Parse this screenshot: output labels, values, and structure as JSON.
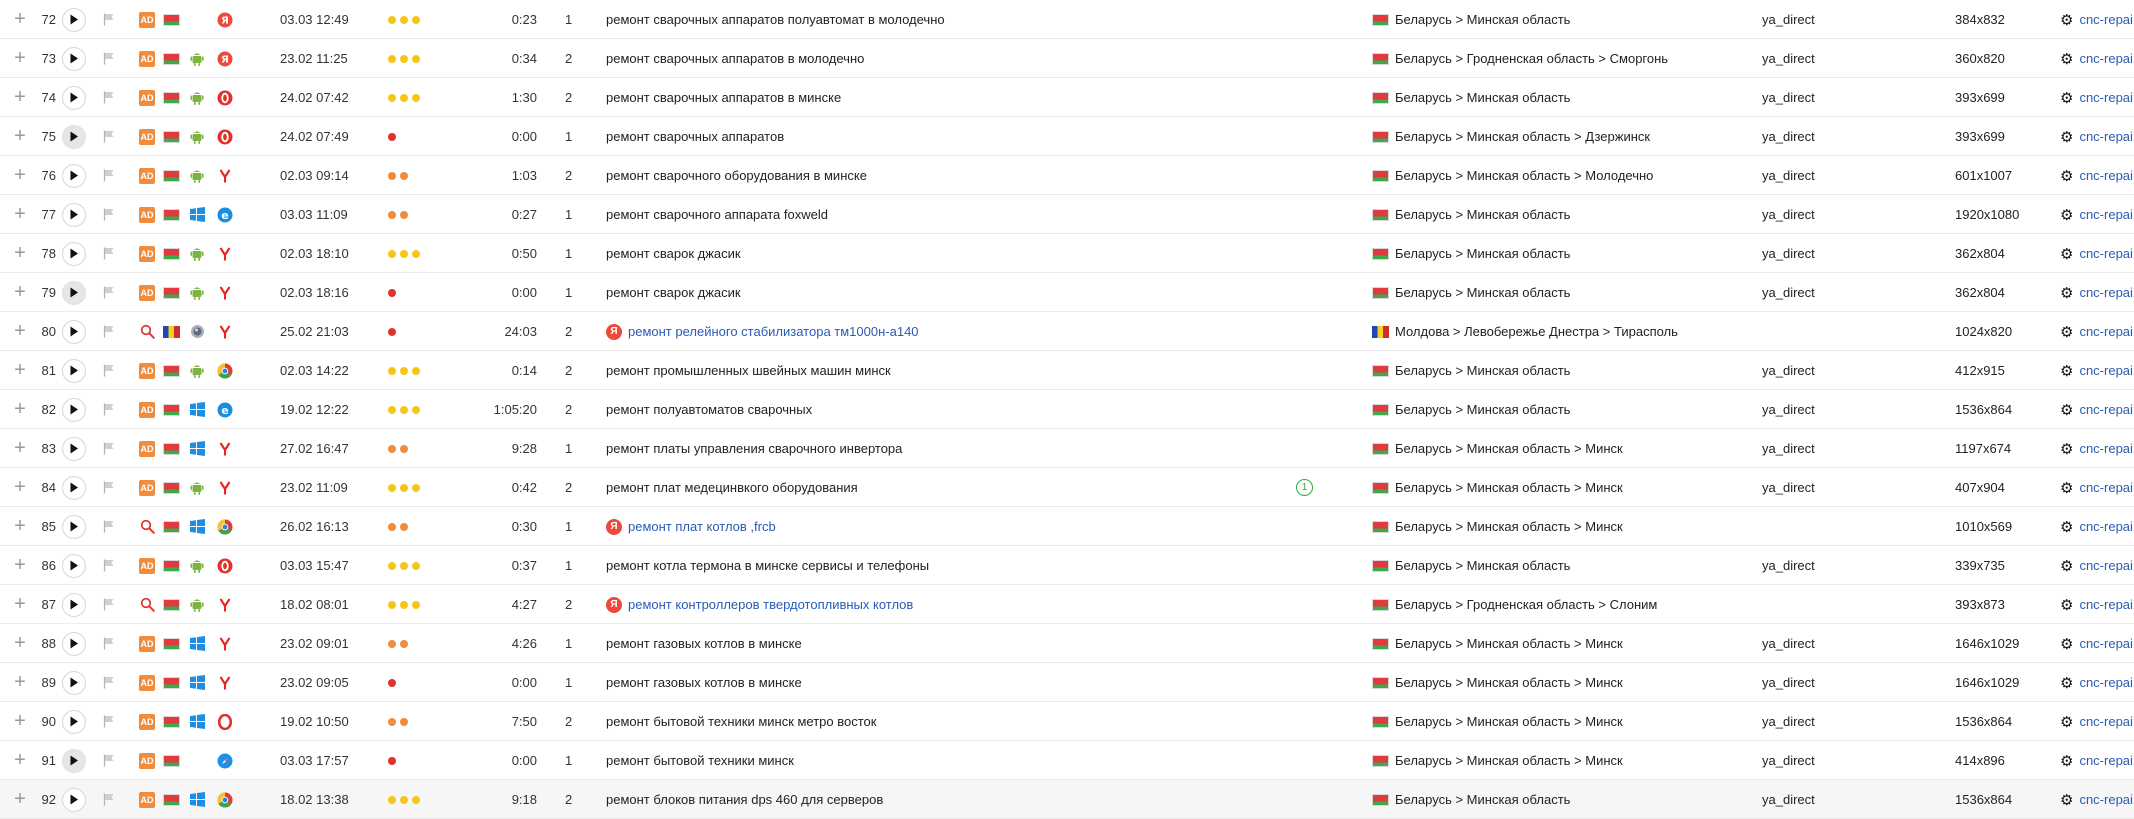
{
  "colors": {
    "dot_orange": "#f08c3c",
    "dot_yellow": "#f5c518",
    "dot_red": "#e0322d",
    "link": "#2a5bb6",
    "ad_badge": "#f08c3c"
  },
  "labels": {
    "ad_badge": "AD",
    "expand_glyph": "+",
    "gear_glyph": "⚙",
    "yandex_glyph": "Я"
  },
  "rows": [
    {
      "num": "72",
      "play_enabled": true,
      "source": "ad",
      "country": "by",
      "os": "none",
      "browser": "yandex-red",
      "date": "03.03 12:49",
      "dots": [
        "y",
        "y",
        "y"
      ],
      "duration": "0:23",
      "depth": "1",
      "phrase": "ремонт сварочных аппаратов полуавтомат в молодечно",
      "phrase_link": false,
      "goal": "",
      "geo": "Беларусь > Минская область",
      "srcname": "ya_direct",
      "res": "384x832",
      "site": "cnc-repai"
    },
    {
      "num": "73",
      "play_enabled": true,
      "source": "ad",
      "country": "by",
      "os": "android",
      "browser": "yandex-red",
      "date": "23.02 11:25",
      "dots": [
        "y",
        "y",
        "y"
      ],
      "duration": "0:34",
      "depth": "2",
      "phrase": "ремонт сварочных аппаратов в молодечно",
      "phrase_link": false,
      "goal": "",
      "geo": "Беларусь > Гродненская область > Сморгонь",
      "srcname": "ya_direct",
      "res": "360x820",
      "site": "cnc-repai"
    },
    {
      "num": "74",
      "play_enabled": true,
      "source": "ad",
      "country": "by",
      "os": "android",
      "browser": "opera-mini",
      "date": "24.02 07:42",
      "dots": [
        "y",
        "y",
        "y"
      ],
      "duration": "1:30",
      "depth": "2",
      "phrase": "ремонт сварочных аппаратов в минске",
      "phrase_link": false,
      "goal": "",
      "geo": "Беларусь > Минская область",
      "srcname": "ya_direct",
      "res": "393x699",
      "site": "cnc-repai"
    },
    {
      "num": "75",
      "play_enabled": false,
      "source": "ad",
      "country": "by",
      "os": "android",
      "browser": "opera-mini",
      "date": "24.02 07:49",
      "dots": [
        "r"
      ],
      "duration": "0:00",
      "depth": "1",
      "phrase": "ремонт сварочных аппаратов",
      "phrase_link": false,
      "goal": "",
      "geo": "Беларусь > Минская область > Дзержинск",
      "srcname": "ya_direct",
      "res": "393x699",
      "site": "cnc-repai"
    },
    {
      "num": "76",
      "play_enabled": true,
      "source": "ad",
      "country": "by",
      "os": "android",
      "browser": "yandex",
      "date": "02.03 09:14",
      "dots": [
        "o",
        "o"
      ],
      "duration": "1:03",
      "depth": "2",
      "phrase": "ремонт сварочного оборудования в минске",
      "phrase_link": false,
      "goal": "",
      "geo": "Беларусь > Минская область > Молодечно",
      "srcname": "ya_direct",
      "res": "601x1007",
      "site": "cnc-repai"
    },
    {
      "num": "77",
      "play_enabled": true,
      "source": "ad",
      "country": "by",
      "os": "windows",
      "browser": "edge",
      "date": "03.03 11:09",
      "dots": [
        "o",
        "o"
      ],
      "duration": "0:27",
      "depth": "1",
      "phrase": "ремонт сварочного аппарата foxweld",
      "phrase_link": false,
      "goal": "",
      "geo": "Беларусь > Минская область",
      "srcname": "ya_direct",
      "res": "1920x1080",
      "site": "cnc-repai"
    },
    {
      "num": "78",
      "play_enabled": true,
      "source": "ad",
      "country": "by",
      "os": "android",
      "browser": "yandex",
      "date": "02.03 18:10",
      "dots": [
        "y",
        "y",
        "y"
      ],
      "duration": "0:50",
      "depth": "1",
      "phrase": "ремонт сварок джасик",
      "phrase_link": false,
      "goal": "",
      "geo": "Беларусь > Минская область",
      "srcname": "ya_direct",
      "res": "362x804",
      "site": "cnc-repai"
    },
    {
      "num": "79",
      "play_enabled": false,
      "source": "ad",
      "country": "by",
      "os": "android",
      "browser": "yandex",
      "date": "02.03 18:16",
      "dots": [
        "r"
      ],
      "duration": "0:00",
      "depth": "1",
      "phrase": "ремонт сварок джасик",
      "phrase_link": false,
      "goal": "",
      "geo": "Беларусь > Минская область",
      "srcname": "ya_direct",
      "res": "362x804",
      "site": "cnc-repai"
    },
    {
      "num": "80",
      "play_enabled": true,
      "source": "search",
      "country": "md",
      "os": "apple",
      "browser": "yandex",
      "date": "25.02 21:03",
      "dots": [
        "r"
      ],
      "duration": "24:03",
      "depth": "2",
      "phrase": "ремонт релейного стабилизатора тм1000н-а140",
      "phrase_link": true,
      "goal": "",
      "geo": "Молдова > Левобережье Днестра > Тирасполь",
      "srcname": "",
      "res": "1024x820",
      "site": "cnc-repai"
    },
    {
      "num": "81",
      "play_enabled": true,
      "source": "ad",
      "country": "by",
      "os": "android",
      "browser": "chrome",
      "date": "02.03 14:22",
      "dots": [
        "y",
        "y",
        "y"
      ],
      "duration": "0:14",
      "depth": "2",
      "phrase": "ремонт промышленных швейных машин минск",
      "phrase_link": false,
      "goal": "",
      "geo": "Беларусь > Минская область",
      "srcname": "ya_direct",
      "res": "412x915",
      "site": "cnc-repai"
    },
    {
      "num": "82",
      "play_enabled": true,
      "source": "ad",
      "country": "by",
      "os": "windows",
      "browser": "edge",
      "date": "19.02 12:22",
      "dots": [
        "y",
        "y",
        "y"
      ],
      "duration": "1:05:20",
      "depth": "2",
      "phrase": "ремонт полуавтоматов сварочных",
      "phrase_link": false,
      "goal": "",
      "geo": "Беларусь > Минская область",
      "srcname": "ya_direct",
      "res": "1536x864",
      "site": "cnc-repai"
    },
    {
      "num": "83",
      "play_enabled": true,
      "source": "ad",
      "country": "by",
      "os": "windows",
      "browser": "yandex",
      "date": "27.02 16:47",
      "dots": [
        "o",
        "o"
      ],
      "duration": "9:28",
      "depth": "1",
      "phrase": "ремонт платы управления сварочного инвертора",
      "phrase_link": false,
      "goal": "",
      "geo": "Беларусь > Минская область > Минск",
      "srcname": "ya_direct",
      "res": "1197x674",
      "site": "cnc-repai"
    },
    {
      "num": "84",
      "play_enabled": true,
      "source": "ad",
      "country": "by",
      "os": "android",
      "browser": "yandex",
      "date": "23.02 11:09",
      "dots": [
        "y",
        "y",
        "y"
      ],
      "duration": "0:42",
      "depth": "2",
      "phrase": "ремонт плат медецинвкого оборудования",
      "phrase_link": false,
      "goal": "1",
      "geo": "Беларусь > Минская область > Минск",
      "srcname": "ya_direct",
      "res": "407x904",
      "site": "cnc-repai"
    },
    {
      "num": "85",
      "play_enabled": true,
      "source": "search",
      "country": "by",
      "os": "windows",
      "browser": "chrome",
      "date": "26.02 16:13",
      "dots": [
        "o",
        "o"
      ],
      "duration": "0:30",
      "depth": "1",
      "phrase": "ремонт плат котлов ,frcb",
      "phrase_link": true,
      "goal": "",
      "geo": "Беларусь > Минская область > Минск",
      "srcname": "",
      "res": "1010x569",
      "site": "cnc-repai"
    },
    {
      "num": "86",
      "play_enabled": true,
      "source": "ad",
      "country": "by",
      "os": "android",
      "browser": "opera-mini",
      "date": "03.03 15:47",
      "dots": [
        "y",
        "y",
        "y"
      ],
      "duration": "0:37",
      "depth": "1",
      "phrase": "ремонт котла термона в минске сервисы и телефоны",
      "phrase_link": false,
      "goal": "",
      "geo": "Беларусь > Минская область",
      "srcname": "ya_direct",
      "res": "339x735",
      "site": "cnc-repai"
    },
    {
      "num": "87",
      "play_enabled": true,
      "source": "search",
      "country": "by",
      "os": "android",
      "browser": "yandex",
      "date": "18.02 08:01",
      "dots": [
        "y",
        "y",
        "y"
      ],
      "duration": "4:27",
      "depth": "2",
      "phrase": "ремонт контроллеров твердотопливных котлов",
      "phrase_link": true,
      "goal": "",
      "geo": "Беларусь > Гродненская область > Слоним",
      "srcname": "",
      "res": "393x873",
      "site": "cnc-repai"
    },
    {
      "num": "88",
      "play_enabled": true,
      "source": "ad",
      "country": "by",
      "os": "windows",
      "browser": "yandex",
      "date": "23.02 09:01",
      "dots": [
        "o",
        "o"
      ],
      "duration": "4:26",
      "depth": "1",
      "phrase": "ремонт газовых котлов в минске",
      "phrase_link": false,
      "goal": "",
      "geo": "Беларусь > Минская область > Минск",
      "srcname": "ya_direct",
      "res": "1646x1029",
      "site": "cnc-repai"
    },
    {
      "num": "89",
      "play_enabled": true,
      "source": "ad",
      "country": "by",
      "os": "windows",
      "browser": "yandex",
      "date": "23.02 09:05",
      "dots": [
        "r"
      ],
      "duration": "0:00",
      "depth": "1",
      "phrase": "ремонт газовых котлов в минске",
      "phrase_link": false,
      "goal": "",
      "geo": "Беларусь > Минская область > Минск",
      "srcname": "ya_direct",
      "res": "1646x1029",
      "site": "cnc-repai"
    },
    {
      "num": "90",
      "play_enabled": true,
      "source": "ad",
      "country": "by",
      "os": "windows",
      "browser": "opera",
      "date": "19.02 10:50",
      "dots": [
        "o",
        "o"
      ],
      "duration": "7:50",
      "depth": "2",
      "phrase": "ремонт бытовой техники минск метро восток",
      "phrase_link": false,
      "goal": "",
      "geo": "Беларусь > Минская область > Минск",
      "srcname": "ya_direct",
      "res": "1536x864",
      "site": "cnc-repai"
    },
    {
      "num": "91",
      "play_enabled": false,
      "source": "ad",
      "country": "by",
      "os": "none",
      "browser": "safari",
      "date": "03.03 17:57",
      "dots": [
        "r"
      ],
      "duration": "0:00",
      "depth": "1",
      "phrase": "ремонт бытовой техники минск",
      "phrase_link": false,
      "goal": "",
      "geo": "Беларусь > Минская область > Минск",
      "srcname": "ya_direct",
      "res": "414x896",
      "site": "cnc-repai"
    },
    {
      "num": "92",
      "play_enabled": true,
      "source": "ad",
      "country": "by",
      "os": "windows",
      "browser": "chrome",
      "date": "18.02 13:38",
      "dots": [
        "y",
        "y",
        "y"
      ],
      "duration": "9:18",
      "depth": "2",
      "phrase": "ремонт блоков питания dps 460 для серверов",
      "phrase_link": false,
      "goal": "",
      "geo": "Беларусь > Минская область",
      "srcname": "ya_direct",
      "res": "1536x864",
      "site": "cnc-repai",
      "highlight": true
    }
  ]
}
